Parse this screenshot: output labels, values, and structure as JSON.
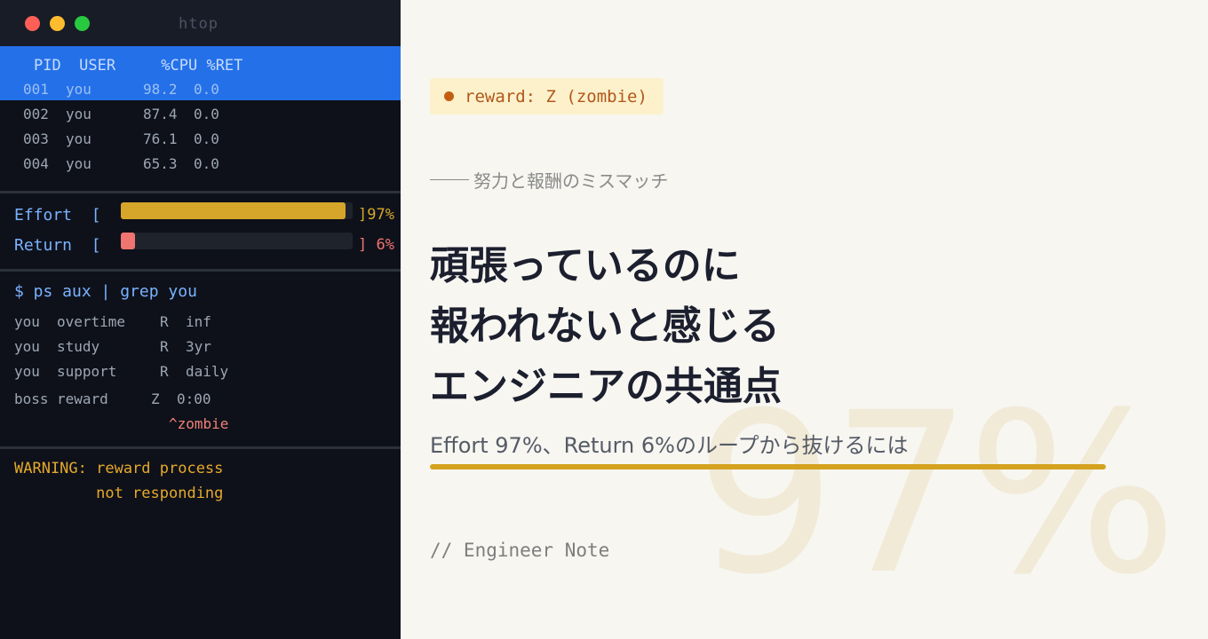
{
  "window": {
    "title": "htop"
  },
  "process_table": {
    "header": "PID  USER     %CPU %RET",
    "rows": [
      {
        "pid": "001",
        "user": "you",
        "cpu": "98.2",
        "ret": "0.0"
      },
      {
        "pid": "002",
        "user": "you",
        "cpu": "87.4",
        "ret": "0.0"
      },
      {
        "pid": "003",
        "user": "you",
        "cpu": "76.1",
        "ret": "0.0"
      },
      {
        "pid": "004",
        "user": "you",
        "cpu": "65.3",
        "ret": "0.0"
      }
    ]
  },
  "meters": {
    "effort": {
      "label": "Effort  [",
      "value": 97,
      "pct_text": "]97%",
      "color": "#d6a62a"
    },
    "return": {
      "label": "Return  [",
      "value": 6,
      "pct_text": "] 6%",
      "color": "#f07470"
    }
  },
  "shell": {
    "command": "$ ps aux | grep you",
    "rows": [
      {
        "user": "you",
        "cmd": "overtime",
        "state": "R",
        "time": "inf"
      },
      {
        "user": "you",
        "cmd": "study",
        "state": "R",
        "time": "3yr"
      },
      {
        "user": "you",
        "cmd": "support",
        "state": "R",
        "time": "daily"
      },
      {
        "user": "boss",
        "cmd": "reward",
        "state": "Z",
        "time": "0:00"
      }
    ],
    "zombie_marker": "^zombie",
    "warning_line1": "WARNING: reward process",
    "warning_line2": "         not responding"
  },
  "article": {
    "badge": "reward: Z (zombie)",
    "eyebrow": "努力と報酬のミスマッチ",
    "title_lines": [
      "頑張っているのに",
      "報われないと感じる",
      "エンジニアの共通点"
    ],
    "subtitle": "Effort 97%、Return 6%のループから抜けるには",
    "background_number": "97%",
    "note": "// Engineer Note"
  },
  "colors": {
    "selection": "#2470e8",
    "accent_gold": "#d4a21e",
    "title_text": "#1c1f2e"
  }
}
